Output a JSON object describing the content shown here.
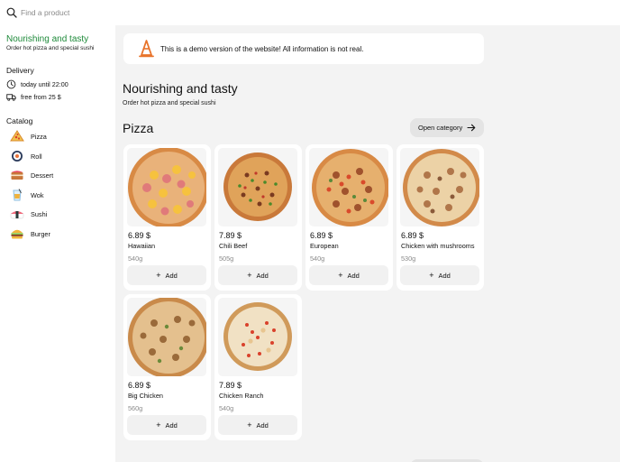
{
  "search": {
    "placeholder": "Find a product",
    "icon": "search-icon"
  },
  "sidebar": {
    "brand_title": "Nourishing and tasty",
    "brand_subtitle": "Order hot pizza and special sushi",
    "brand_color": "#1e8a3a",
    "delivery": {
      "title": "Delivery",
      "hours": "today until 22:00",
      "free_from": "free from 25 $"
    },
    "catalog": {
      "title": "Catalog",
      "items": [
        {
          "label": "Pizza",
          "icon": "pizza-icon"
        },
        {
          "label": "Roll",
          "icon": "roll-icon"
        },
        {
          "label": "Dessert",
          "icon": "dessert-icon"
        },
        {
          "label": "Wok",
          "icon": "wok-icon"
        },
        {
          "label": "Sushi",
          "icon": "sushi-icon"
        },
        {
          "label": "Burger",
          "icon": "burger-icon"
        }
      ]
    }
  },
  "notice": {
    "text": "This is a demo version of the website! All information is not real.",
    "icon": "warning-cone-icon",
    "accent": "#e8732a"
  },
  "main": {
    "title": "Nourishing and tasty",
    "subtitle": "Order hot pizza and special sushi",
    "section_title": "Pizza",
    "open_category": "Open category"
  },
  "products": [
    {
      "price": "6.89 $",
      "name": "Hawaiian",
      "weight": "540g",
      "add": "Add"
    },
    {
      "price": "7.89 $",
      "name": "Chili Beef",
      "weight": "505g",
      "add": "Add"
    },
    {
      "price": "6.89 $",
      "name": "European",
      "weight": "540g",
      "add": "Add"
    },
    {
      "price": "6.89 $",
      "name": "Chicken with mushrooms",
      "weight": "530g",
      "add": "Add"
    },
    {
      "price": "6.89 $",
      "name": "Big Chicken",
      "weight": "560g",
      "add": "Add"
    },
    {
      "price": "7.89 $",
      "name": "Chicken Ranch",
      "weight": "540g",
      "add": "Add"
    }
  ]
}
